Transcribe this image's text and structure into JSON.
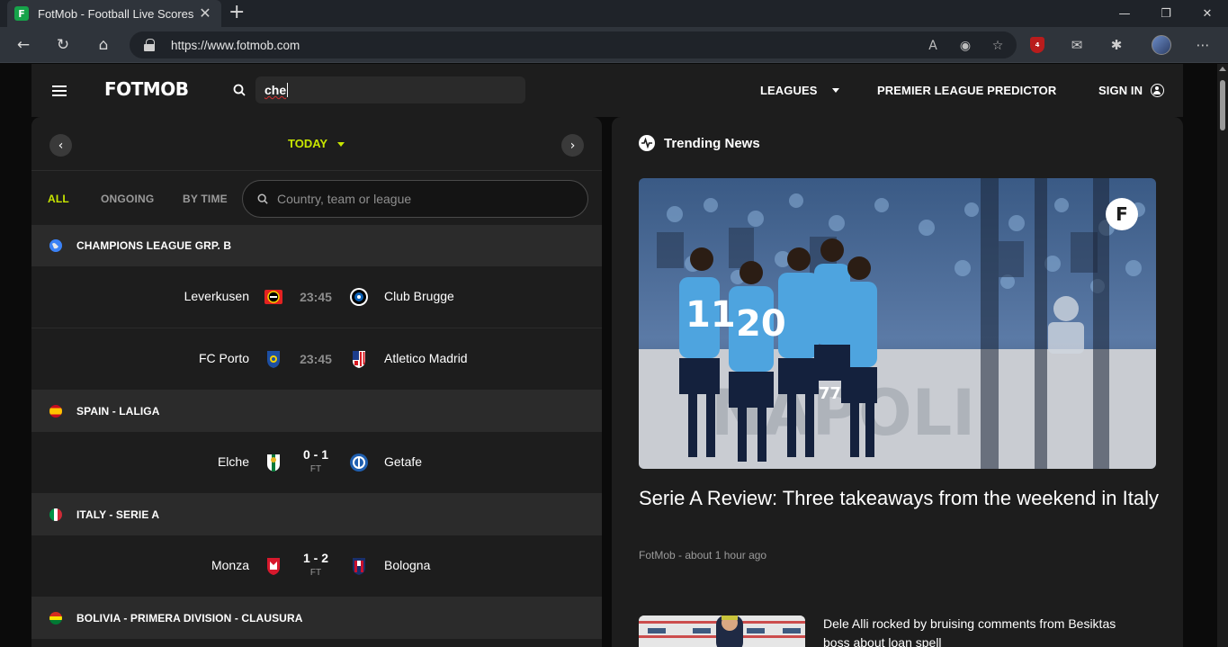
{
  "browser": {
    "tab_title": "FotMob - Football Live Scores",
    "url": "https://www.fotmob.com",
    "extension_badge": "4"
  },
  "site": {
    "logo": "FOTMOB",
    "search_value": "che",
    "nav": {
      "leagues": "LEAGUES",
      "predictor": "PREMIER LEAGUE PREDICTOR",
      "sign_in": "SIGN IN"
    }
  },
  "matches": {
    "date_label": "TODAY",
    "filters": [
      "ALL",
      "ONGOING",
      "BY TIME"
    ],
    "filter_search_placeholder": "Country, team or league",
    "leagues": [
      {
        "name": "CHAMPIONS LEAGUE GRP. B",
        "matches": [
          {
            "home": "Leverkusen",
            "away": "Club Brugge",
            "time": "23:45"
          },
          {
            "home": "FC Porto",
            "away": "Atletico Madrid",
            "time": "23:45"
          }
        ]
      },
      {
        "name": "SPAIN - LALIGA",
        "matches": [
          {
            "home": "Elche",
            "away": "Getafe",
            "score": "0 - 1",
            "status": "FT"
          }
        ]
      },
      {
        "name": "ITALY - SERIE A",
        "matches": [
          {
            "home": "Monza",
            "away": "Bologna",
            "score": "1 - 2",
            "status": "FT"
          }
        ]
      },
      {
        "name": "BOLIVIA - PRIMERA DIVISION - CLAUSURA",
        "matches": []
      }
    ]
  },
  "news": {
    "section_title": "Trending News",
    "lead": {
      "headline": "Serie A Review: Three takeaways from the weekend in Italy",
      "byline": "FotMob - about 1 hour ago"
    },
    "second": {
      "headline": "Dele Alli rocked by bruising comments from Besiktas boss about loan spell"
    }
  },
  "colors": {
    "accent": "#c8e600",
    "background": "#1d1d1d",
    "league_row": "#2b2b2b"
  }
}
